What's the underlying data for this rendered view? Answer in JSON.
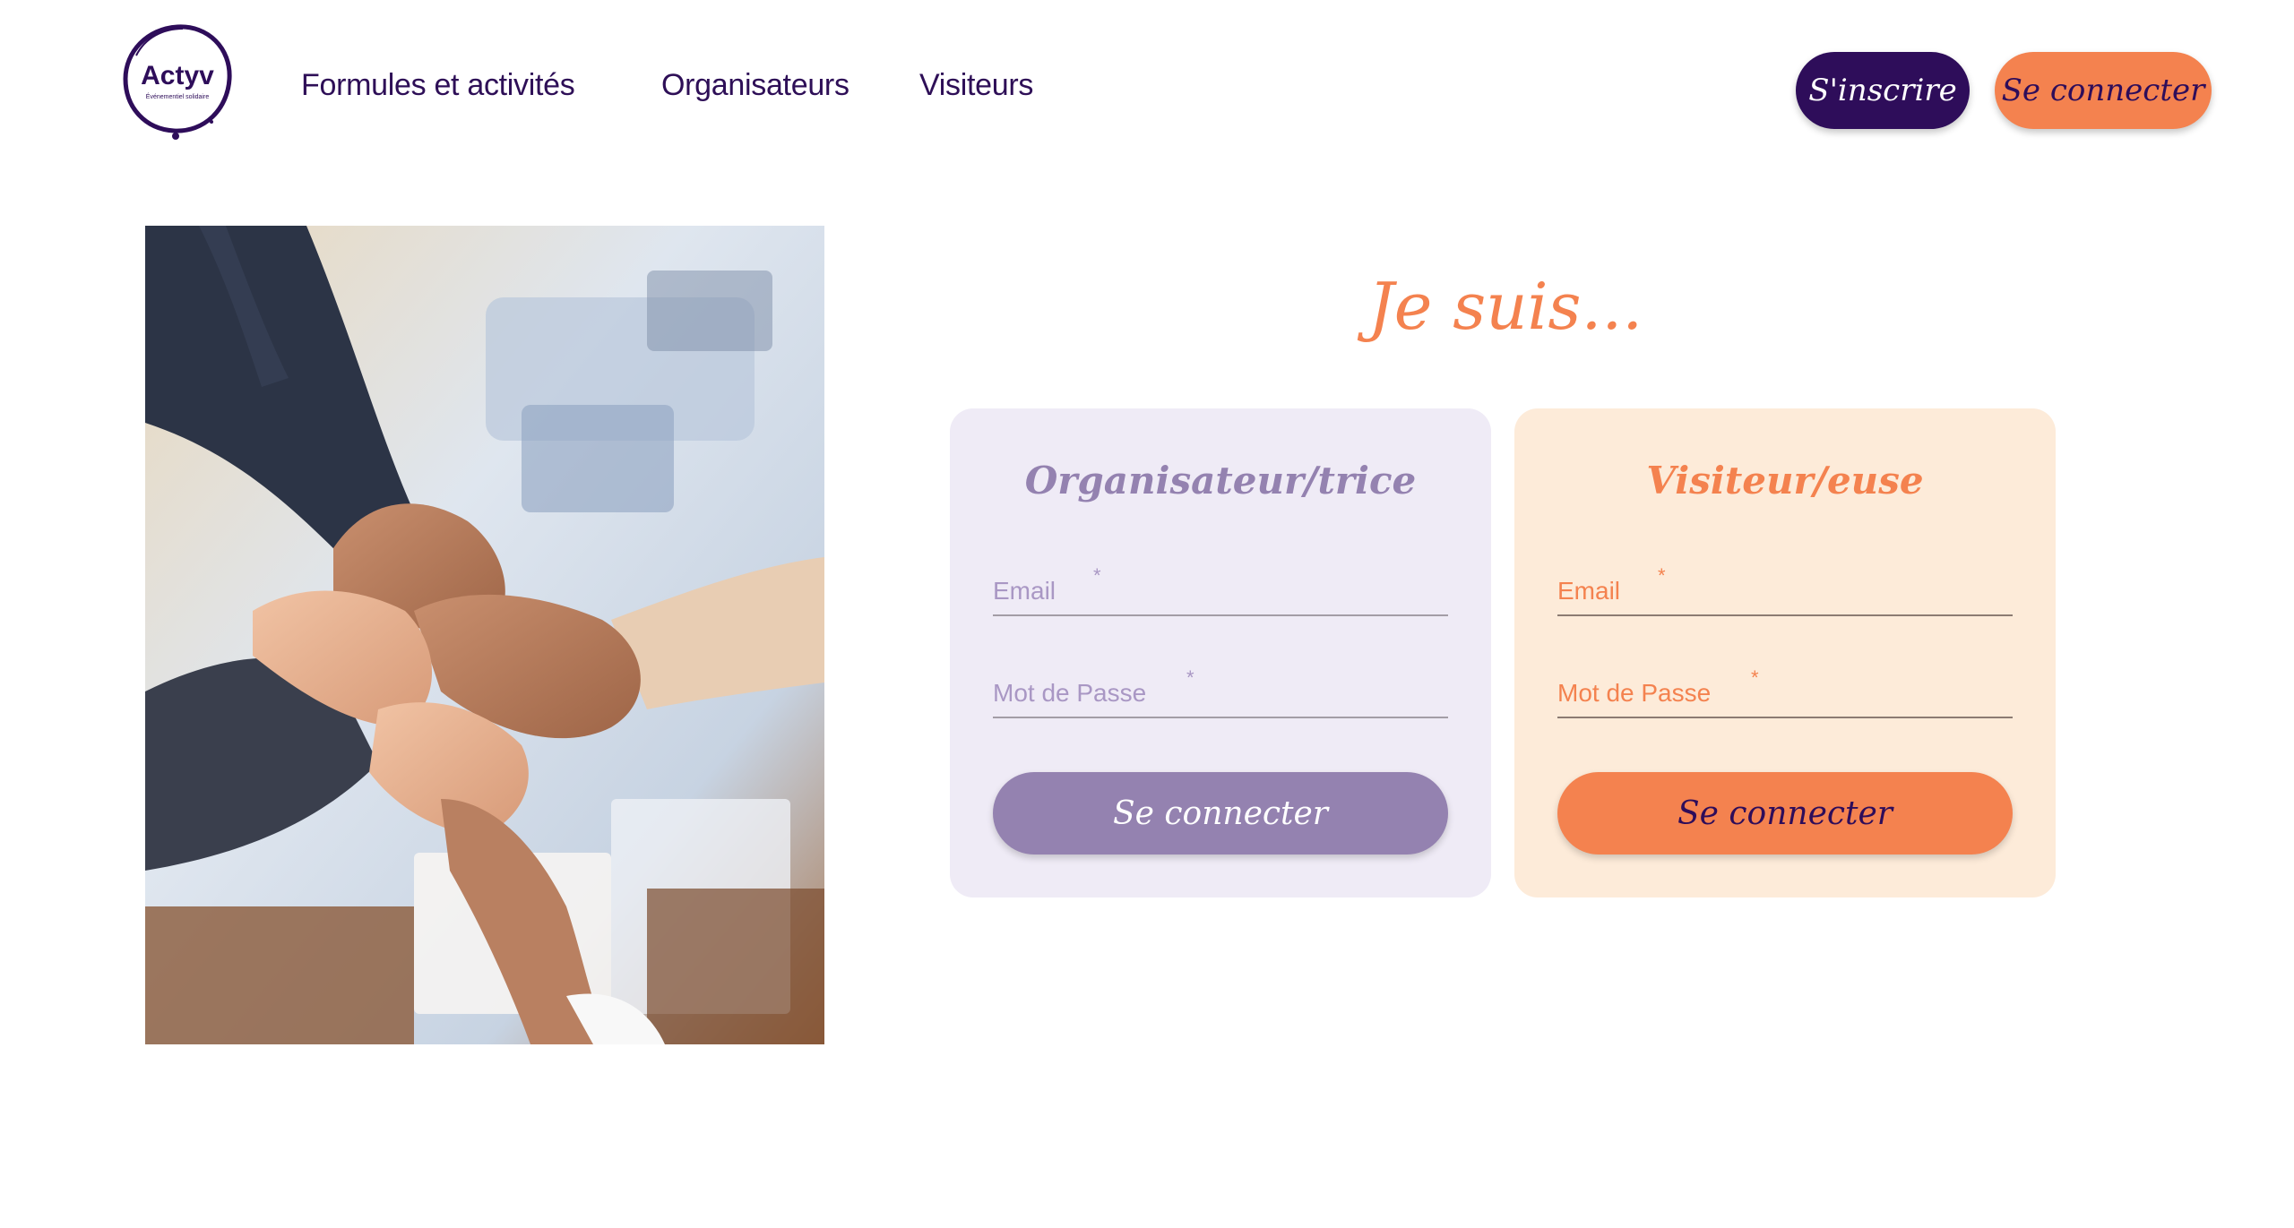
{
  "brand": {
    "name": "Actyv",
    "tagline": "Événementiel solidaire"
  },
  "nav": {
    "items": [
      {
        "label": "Formules et activités"
      },
      {
        "label": "Organisateurs"
      },
      {
        "label": "Visiteurs"
      }
    ]
  },
  "header_actions": {
    "signup_label": "S'inscrire",
    "login_label": "Se connecter"
  },
  "main": {
    "heading": "Je suis...",
    "cards": [
      {
        "title": "Organisateur/trice",
        "email_placeholder": "Email",
        "password_placeholder": "Mot de Passe",
        "required_mark": "*",
        "submit_label": "Se connecter"
      },
      {
        "title": "Visiteur/euse",
        "email_placeholder": "Email",
        "password_placeholder": "Mot de Passe",
        "required_mark": "*",
        "submit_label": "Se connecter"
      }
    ]
  },
  "colors": {
    "primary_purple": "#2e0d5a",
    "accent_orange": "#f4824f",
    "lavender": "#9482b0",
    "lavender_bg": "#efebf6",
    "peach_bg": "#fdebd9"
  },
  "icons": {
    "photo": "team-hands-stacked-photo"
  }
}
